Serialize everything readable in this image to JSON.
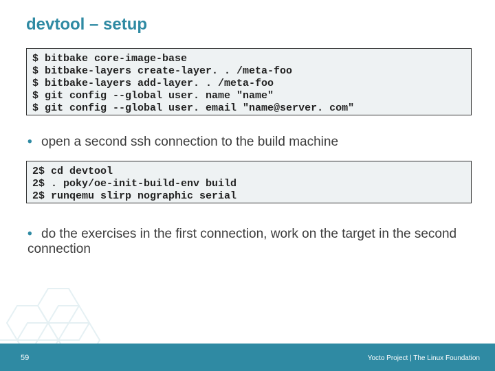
{
  "title": "devtool – setup",
  "code1": {
    "l0": "$ bitbake core-image-base",
    "l1": "$ bitbake-layers create-layer. . /meta-foo",
    "l2": "$ bitbake-layers add-layer. . /meta-foo",
    "l3": "$ git config --global user. name \"name\"",
    "l4": "$ git config --global user. email \"name@server. com\""
  },
  "bullet1": "open a second ssh connection to the build machine",
  "code2": {
    "l0": "2$ cd devtool",
    "l1": "2$ . poky/oe-init-build-env build",
    "l2": "2$ runqemu slirp nographic serial"
  },
  "bullet2": "do the exercises in the first connection, work on the target in the second connection",
  "page": "59",
  "footer": "Yocto Project | The Linux Foundation"
}
